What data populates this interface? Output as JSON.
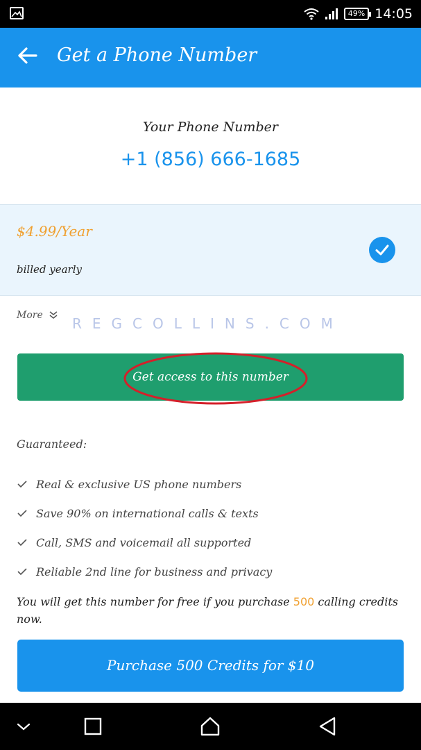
{
  "status_bar": {
    "battery": "49%",
    "time": "14:05",
    "icons": [
      "gallery-icon",
      "wifi-icon",
      "signal-icon",
      "battery-icon"
    ]
  },
  "app_bar": {
    "title": "Get a Phone Number",
    "back_icon": "arrow-left-icon",
    "color": "#1993ec"
  },
  "phone": {
    "label": "Your Phone Number",
    "number": "+1 (856) 666-1685"
  },
  "plan": {
    "price": "$4.99/Year",
    "billing": "billed yearly",
    "selected": true,
    "price_color": "#f0a030"
  },
  "more": {
    "label": "More",
    "icon": "double-chevron-down-icon"
  },
  "watermark": "REGCOLLINS.COM",
  "access_button": {
    "label": "Get access to this number",
    "color": "#1f9e6e"
  },
  "guaranteed": {
    "title": "Guaranteed:",
    "items": [
      "Real & exclusive US phone numbers",
      "Save 90% on international calls & texts",
      "Call, SMS and voicemail all supported",
      "Reliable 2nd line for business and privacy"
    ]
  },
  "free_note": {
    "before": "You will get this number for free if you purchase ",
    "credits": "500",
    "after": " calling credits now."
  },
  "purchase_button": {
    "label": "Purchase 500 Credits for $10"
  },
  "nav_bar": {
    "icons": [
      "chevron-down-icon",
      "recents-icon",
      "home-icon",
      "back-icon"
    ]
  }
}
